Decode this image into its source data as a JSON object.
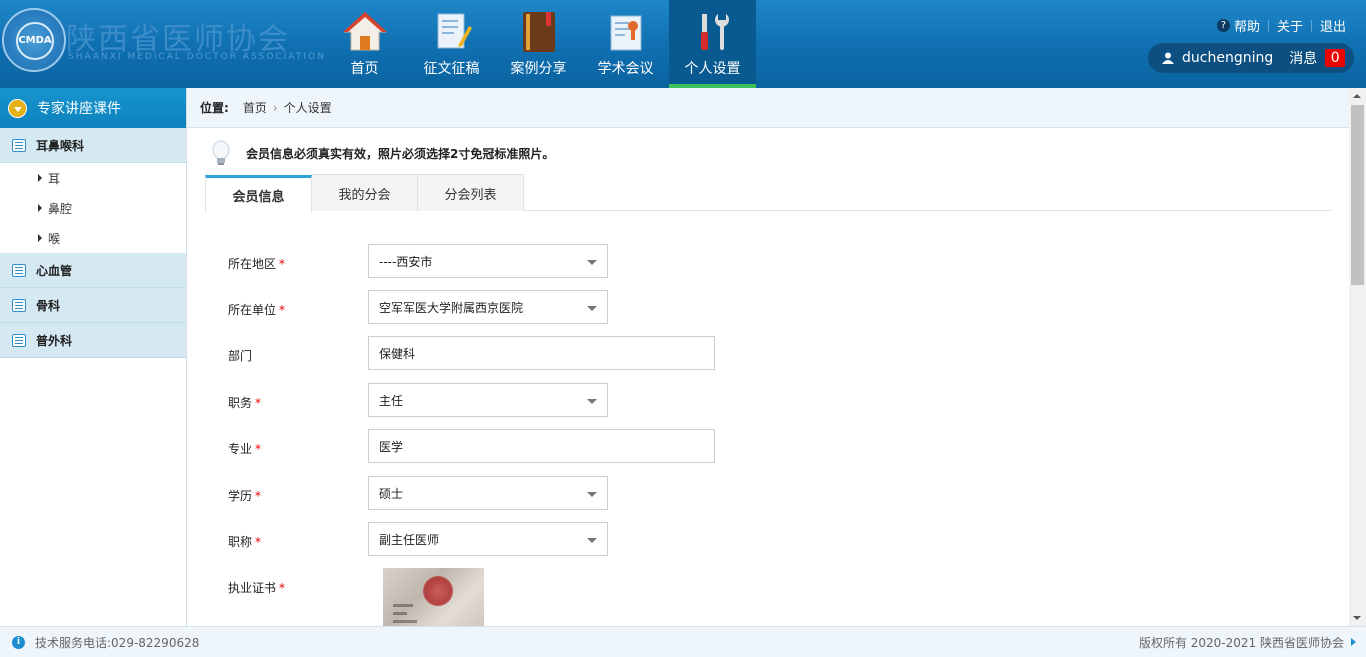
{
  "header": {
    "logo_text": "CMDA",
    "site_title": "陕西省医师协会",
    "site_subtitle": "SHAANXI MEDICAL DOCTOR ASSOCIATION",
    "nav": [
      {
        "label": "首页",
        "icon": "house-icon"
      },
      {
        "label": "征文征稿",
        "icon": "document-pen-icon"
      },
      {
        "label": "案例分享",
        "icon": "book-icon"
      },
      {
        "label": "学术会议",
        "icon": "certificate-icon"
      },
      {
        "label": "个人设置",
        "icon": "tools-icon",
        "active": true
      }
    ],
    "help_label": "帮助",
    "about_label": "关于",
    "logout_label": "退出",
    "username": "duchengning",
    "message_label": "消息",
    "message_count": "0"
  },
  "sidebar": {
    "title": "专家讲座课件",
    "categories": [
      {
        "label": "耳鼻喉科",
        "children": [
          "耳",
          "鼻腔",
          "喉"
        ]
      },
      {
        "label": "心血管",
        "children": []
      },
      {
        "label": "骨科",
        "children": []
      },
      {
        "label": "普外科",
        "children": []
      }
    ]
  },
  "breadcrumb": {
    "label": "位置:",
    "home": "首页",
    "current": "个人设置"
  },
  "notice": "会员信息必须真实有效，照片必须选择2寸免冠标准照片。",
  "tabs": [
    "会员信息",
    "我的分会",
    "分会列表"
  ],
  "form": {
    "region": {
      "label": "所在地区",
      "value": "----西安市"
    },
    "unit": {
      "label": "所在单位",
      "value": "空军军医大学附属西京医院"
    },
    "department": {
      "label": "部门",
      "value": "保健科"
    },
    "position": {
      "label": "职务",
      "value": "主任"
    },
    "major": {
      "label": "专业",
      "value": "医学"
    },
    "education": {
      "label": "学历",
      "value": "硕士"
    },
    "title": {
      "label": "职称",
      "value": "副主任医师"
    },
    "license": {
      "label": "执业证书"
    }
  },
  "footer": {
    "phone": "技术服务电话:029-82290628",
    "copyright": "版权所有 2020-2021 陕西省医师协会"
  },
  "colors": {
    "header_blue": "#0f6fb0",
    "active_nav_underline": "#3cc05c",
    "badge_red": "#e00000",
    "tab_accent": "#2aa3d8"
  }
}
